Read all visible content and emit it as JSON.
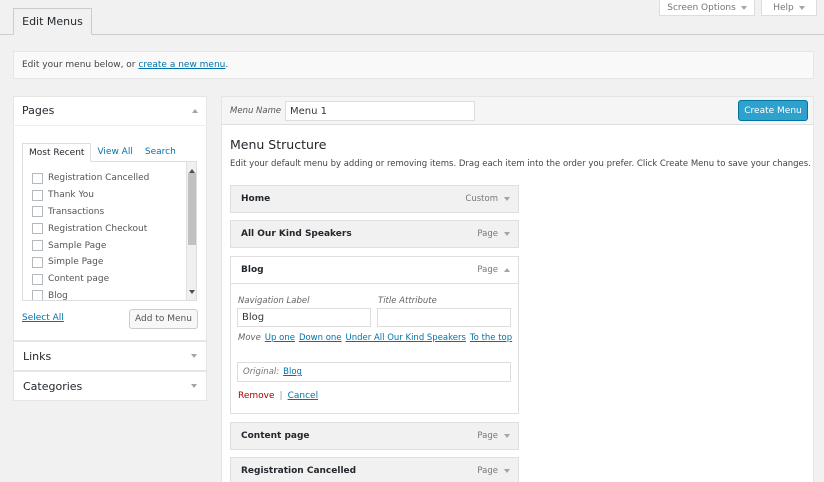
{
  "top": {
    "tab_label": "Edit Menus",
    "screen_options": "Screen Options",
    "help": "Help"
  },
  "notice": {
    "text": "Edit your menu below, or ",
    "link": "create a new menu",
    "suffix": "."
  },
  "sidebar": {
    "pages": {
      "title": "Pages",
      "tabs": [
        "Most Recent",
        "View All",
        "Search"
      ],
      "items": [
        "Registration Cancelled",
        "Thank You",
        "Transactions",
        "Registration Checkout",
        "Sample Page",
        "Simple Page",
        "Content page",
        "Blog"
      ],
      "select_all": "Select All",
      "add_button": "Add to Menu"
    },
    "links": {
      "title": "Links"
    },
    "categories": {
      "title": "Categories"
    }
  },
  "main": {
    "menu_name_label": "Menu Name",
    "menu_name_value": "Menu 1",
    "create_button": "Create Menu",
    "structure_title": "Menu Structure",
    "structure_desc": "Edit your default menu by adding or removing items. Drag each item into the order you prefer. Click Create Menu to save your changes.",
    "items": [
      {
        "title": "Home",
        "type": "Custom"
      },
      {
        "title": "All Our Kind Speakers",
        "type": "Page"
      },
      {
        "title": "Blog",
        "type": "Page"
      },
      {
        "title": "Content page",
        "type": "Page"
      },
      {
        "title": "Registration Cancelled",
        "type": "Page"
      }
    ],
    "expanded": {
      "nav_label": "Navigation Label",
      "nav_value": "Blog",
      "title_attr_label": "Title Attribute",
      "title_attr_value": "",
      "move_label": "Move",
      "move_links": [
        "Up one",
        "Down one",
        "Under All Our Kind Speakers",
        "To the top"
      ],
      "original_label": "Original:",
      "original_link": "Blog",
      "remove": "Remove",
      "separator": "|",
      "cancel": "Cancel"
    }
  },
  "colors": {
    "primary": "#2ea2cc",
    "link": "#0073aa",
    "background": "#f1f1f1"
  }
}
